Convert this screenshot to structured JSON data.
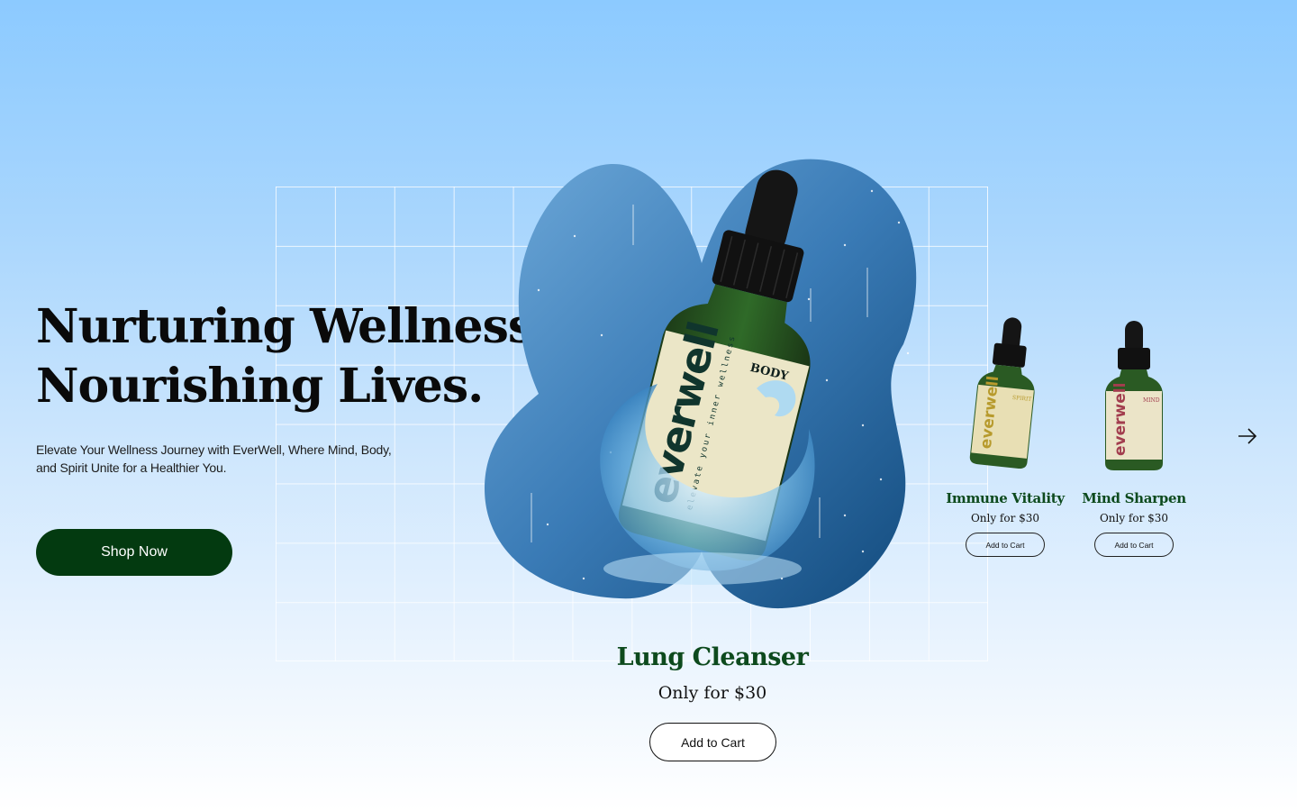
{
  "hero": {
    "title_line1": "Nurturing Wellness,",
    "title_line2": "Nourishing Lives.",
    "subtitle": "Elevate Your Wellness Journey with EverWell, Where Mind, Body, and Spirit Unite for a Healthier You.",
    "cta_label": "Shop Now"
  },
  "featured_product": {
    "brand": "everwell",
    "tagline": "elevate your inner wellness",
    "variant": "BODY",
    "name": "Lung Cleanser",
    "price": "Only for $30",
    "cart_label": "Add to Cart"
  },
  "carousel": {
    "items": [
      {
        "name": "Immune Vitality",
        "variant": "SPIRIT",
        "brand": "everwell",
        "price": "Only for $30",
        "cart_label": "Add to Cart"
      },
      {
        "name": "Mind Sharpen",
        "variant": "MIND",
        "brand": "everwell",
        "price": "Only for $30",
        "cart_label": "Add to Cart"
      }
    ],
    "next_icon": "arrow-right-icon"
  },
  "colors": {
    "brand_green": "#033a10",
    "title_green": "#0d4a1d",
    "blob_blue": "#2f6ea8",
    "sky_blue": "#8ccaff"
  }
}
